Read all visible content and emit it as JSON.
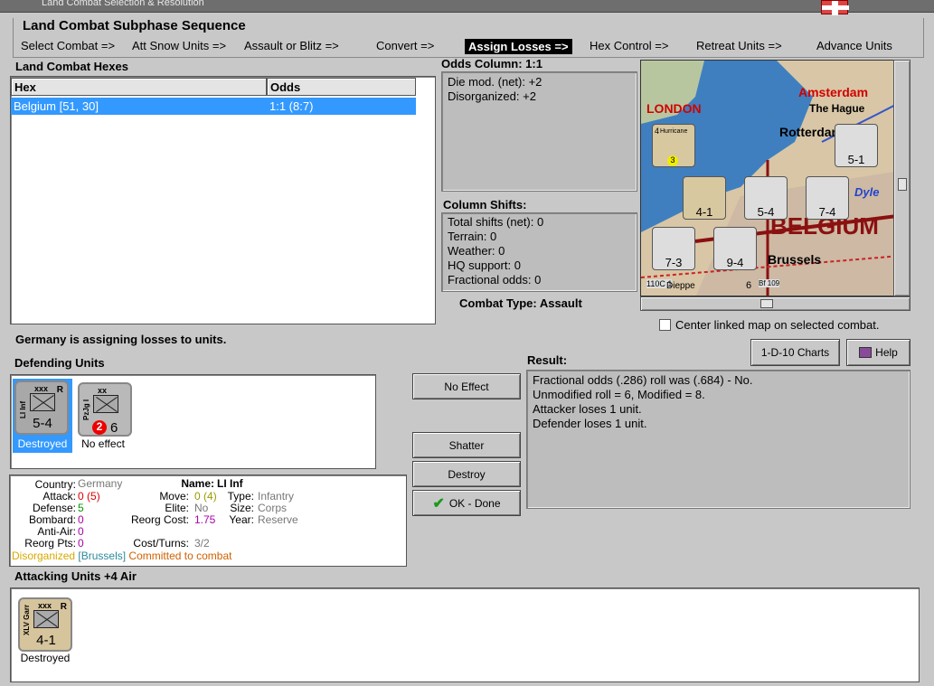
{
  "window": {
    "title": "Land Combat Selection & Resolution"
  },
  "sequence": {
    "title": "Land Combat Subphase Sequence",
    "steps": [
      "Select Combat =>",
      "Att Snow Units =>",
      "Assault or Blitz =>",
      "Convert =>",
      "Assign Losses =>",
      "Hex Control =>",
      "Retreat Units =>",
      "Advance Units"
    ],
    "active_index": 4
  },
  "hexes": {
    "title": "Land Combat Hexes",
    "col_hex": "Hex",
    "col_odds": "Odds",
    "rows": [
      {
        "hex": "Belgium [51, 30]",
        "odds": "1:1 (8:7)"
      }
    ]
  },
  "odds": {
    "title": "Odds Column: 1:1",
    "lines": [
      "Die mod. (net): +2",
      "Disorganized: +2"
    ]
  },
  "shifts": {
    "title": "Column Shifts:",
    "lines": [
      "Total shifts (net): 0",
      "Terrain: 0",
      "Weather: 0",
      "HQ support: 0",
      "Fractional odds: 0"
    ]
  },
  "combat_type": "Combat Type:  Assault",
  "map": {
    "labels": [
      "Amsterdam",
      "The Hague",
      "LONDON",
      "Rotterdam",
      "BELGIUM",
      "Brussels",
      "Dyle",
      "Hurricane",
      "Dieppe",
      "Bf 109",
      "110C 1"
    ],
    "counters": [
      {
        "value": "5-1",
        "size": "xxx"
      },
      {
        "value": "4-1",
        "size": "xxx"
      },
      {
        "value": "5-4",
        "size": "xxx"
      },
      {
        "value": "7-4",
        "size": "xxx"
      },
      {
        "value": "7-3",
        "size": "xxx"
      },
      {
        "value": "9-4",
        "size": "xxx"
      }
    ],
    "air": {
      "value": "4",
      "extra": "3"
    },
    "stack_counts": [
      "2",
      "2",
      "2"
    ],
    "bottom_left_val": "6"
  },
  "center_map_label": "Center linked map on selected combat.",
  "status": "Germany is assigning losses to units.",
  "buttons": {
    "charts": "1-D-10 Charts",
    "help": "Help",
    "no_effect": "No Effect",
    "shatter": "Shatter",
    "destroy": "Destroy",
    "ok": "OK - Done"
  },
  "defending": {
    "title": "Defending Units",
    "units": [
      {
        "side_label": "LI Inf",
        "size": "xxx",
        "reorg": "R",
        "value": "5-4",
        "status": "Destroyed"
      },
      {
        "side_label": "PzJg I",
        "size": "xx",
        "badge": "2",
        "value": "6",
        "status": "No effect"
      }
    ]
  },
  "result": {
    "title": "Result:",
    "lines": [
      "Fractional odds (.286) roll was (.684)  - No.",
      "Unmodified roll = 6, Modified = 8.",
      "Attacker loses 1 unit.",
      "Defender loses 1 unit."
    ]
  },
  "unit_info": {
    "country_label": "Country:",
    "country": "Germany",
    "attack_label": "Attack:",
    "attack": "0",
    "attack_orig": "(5)",
    "defense_label": "Defense:",
    "defense": "5",
    "bombard_label": "Bombard:",
    "bombard": "0",
    "antiair_label": "Anti-Air:",
    "antiair": "0",
    "reorg_pts_label": "Reorg Pts:",
    "reorg_pts": "0",
    "name_label": "Name:",
    "name": "LI Inf",
    "move_label": "Move:",
    "move": "0",
    "move_orig": "(4)",
    "elite_label": "Elite:",
    "elite": "No",
    "reorg_cost_label": "Reorg Cost:",
    "reorg_cost": "1.75",
    "cost_turns_label": "Cost/Turns:",
    "cost_turns": "3/2",
    "type_label": "Type:",
    "type": "Infantry",
    "size_label": "Size:",
    "size": "Corps",
    "year_label": "Year:",
    "year": "Reserve",
    "status_disorg": "Disorganized",
    "status_hex": "[Brussels]",
    "status_committed": "Committed to combat"
  },
  "attacking": {
    "title": "Attacking Units +4 Air",
    "units": [
      {
        "side_label": "XLV Garr",
        "size": "xxx",
        "reorg": "R",
        "value": "4-1",
        "status": "Destroyed"
      }
    ]
  }
}
